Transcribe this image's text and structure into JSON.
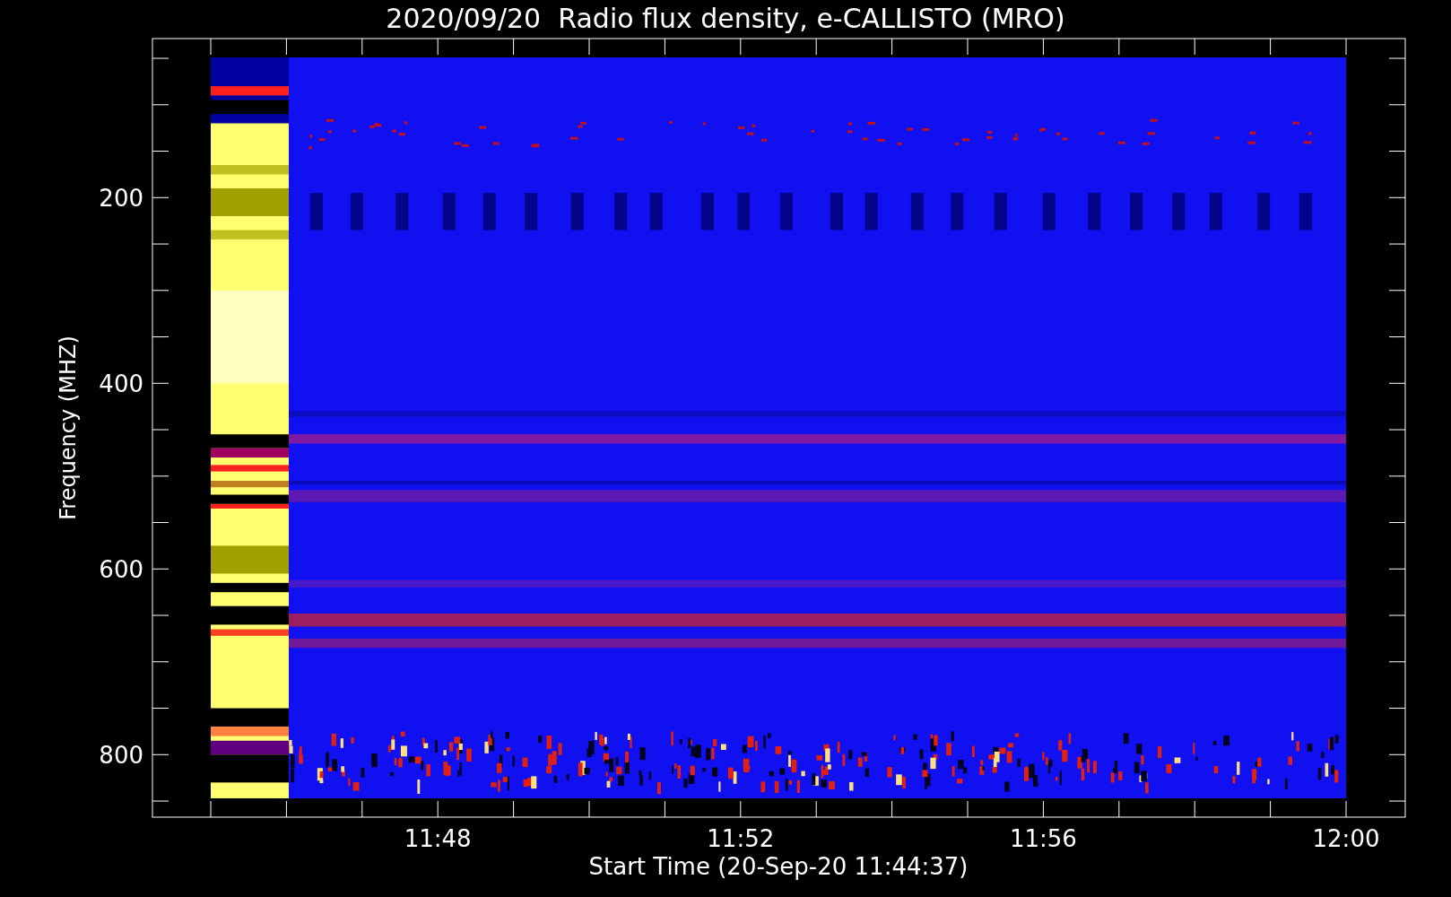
{
  "title": "2020/09/20  Radio flux density, e-CALLISTO (MRO)",
  "y_axis": {
    "label": "Frequency (MHZ)",
    "ticks": [
      "200",
      "400",
      "600",
      "800"
    ]
  },
  "x_axis": {
    "label": "Start Time (20-Sep-20 11:44:37)",
    "ticks": [
      "11:48",
      "11:52",
      "11:56",
      "12:00"
    ]
  }
}
